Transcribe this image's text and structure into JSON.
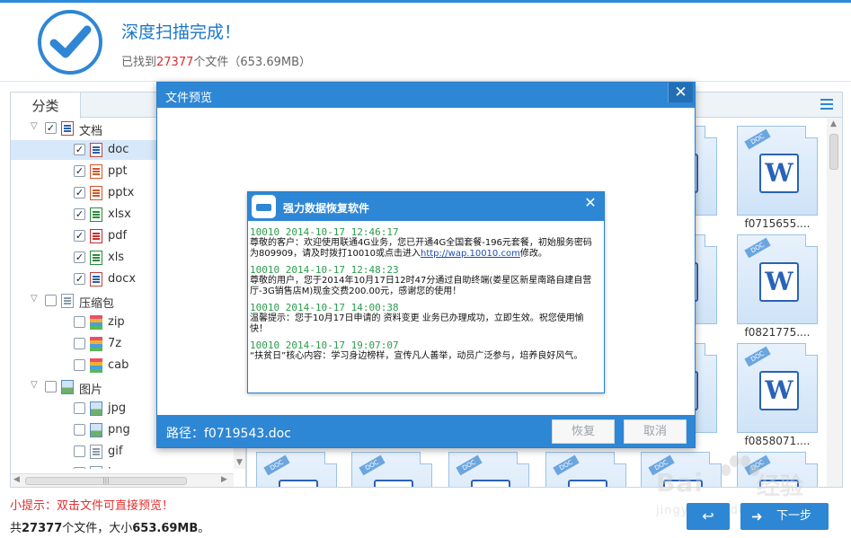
{
  "header": {
    "title": "深度扫描完成！",
    "found_prefix": "已找到",
    "found_count": "27377",
    "found_suffix": "个文件（653.69MB）"
  },
  "left_panel": {
    "tab_label": "分类",
    "tree": [
      {
        "label": "文档",
        "level": 0,
        "expanded": true,
        "checked": true,
        "icon": "document-icon"
      },
      {
        "label": "doc",
        "level": 1,
        "checked": true,
        "selected": true,
        "icon": "doc-file-icon"
      },
      {
        "label": "ppt",
        "level": 1,
        "checked": true,
        "icon": "ppt-file-icon"
      },
      {
        "label": "pptx",
        "level": 1,
        "checked": true,
        "icon": "pptx-file-icon"
      },
      {
        "label": "xlsx",
        "level": 1,
        "checked": true,
        "icon": "xlsx-file-icon"
      },
      {
        "label": "pdf",
        "level": 1,
        "checked": true,
        "icon": "pdf-file-icon"
      },
      {
        "label": "xls",
        "level": 1,
        "checked": true,
        "icon": "xls-file-icon"
      },
      {
        "label": "docx",
        "level": 1,
        "checked": true,
        "icon": "docx-file-icon"
      },
      {
        "label": "压缩包",
        "level": 0,
        "expanded": true,
        "checked": false,
        "icon": "archive-icon"
      },
      {
        "label": "zip",
        "level": 1,
        "checked": false,
        "icon": "zip-file-icon"
      },
      {
        "label": "7z",
        "level": 1,
        "checked": false,
        "icon": "7z-file-icon"
      },
      {
        "label": "cab",
        "level": 1,
        "checked": false,
        "icon": "cab-file-icon"
      },
      {
        "label": "图片",
        "level": 0,
        "expanded": true,
        "checked": false,
        "icon": "image-icon"
      },
      {
        "label": "jpg",
        "level": 1,
        "checked": false,
        "icon": "jpg-file-icon"
      },
      {
        "label": "png",
        "level": 1,
        "checked": false,
        "icon": "png-file-icon"
      },
      {
        "label": "gif",
        "level": 1,
        "checked": false,
        "icon": "gif-file-icon"
      },
      {
        "label": "ico",
        "level": 1,
        "checked": false,
        "icon": "ico-file-icon"
      }
    ]
  },
  "file_grid": {
    "tiles": [
      {
        "name": "f0715655....",
        "tag": "DOC"
      },
      {
        "name": "f0821775....",
        "tag": "DOC"
      },
      {
        "name": "f0858071....",
        "tag": "DOC"
      }
    ],
    "tile_tag": "DOC",
    "word_glyph": "W"
  },
  "preview_modal": {
    "title": "文件预览",
    "path_label": "路径：f0719543.doc",
    "restore_label": "恢复",
    "cancel_label": "取消",
    "sms_window": {
      "title": "强力数据恢复软件",
      "messages": [
        {
          "header": "10010 2014-10-17 12:46:17",
          "text": "尊敬的客户：欢迎使用联通4G业务，您已开通4G全国套餐-196元套餐，初始服务密码为809909，请及时拨打10010或点击进入",
          "link": "http://wap.10010.com",
          "text_after": "修改。"
        },
        {
          "header": "10010 2014-10-17 12:48:23",
          "text": "尊敬的用户，您于2014年10月17日12时47分通过自助终端(娄星区新星南路自建自营厅-3G销售店M)现金交费200.00元，感谢您的使用！",
          "link": "",
          "text_after": ""
        },
        {
          "header": "10010 2014-10-17 14:00:38",
          "text": "温馨提示：您于10月17日申请的 资料变更 业务已办理成功，立即生效。祝您使用愉快！",
          "link": "",
          "text_after": ""
        },
        {
          "header": "10010 2014-10-17 19:07:07",
          "text": "“扶贫日”核心内容：学习身边榜样，宣传凡人善举，动员广泛参与，培养良好风气。",
          "link": "",
          "text_after": ""
        }
      ]
    }
  },
  "footer": {
    "tip": "小提示：双击文件可直接预览！",
    "summary_prefix": "共",
    "summary_count": "27377",
    "summary_mid": "个文件，大小",
    "summary_size": "653.69MB",
    "summary_suffix": "。",
    "next_label": "下一步"
  },
  "watermark": {
    "brand": "Bai",
    "brand2": "经验",
    "url": "jingyan.baidu.com"
  },
  "colors": {
    "accent": "#2e87d4",
    "highlight": "#e02a2a",
    "selected_row": "#d6e8fa"
  }
}
